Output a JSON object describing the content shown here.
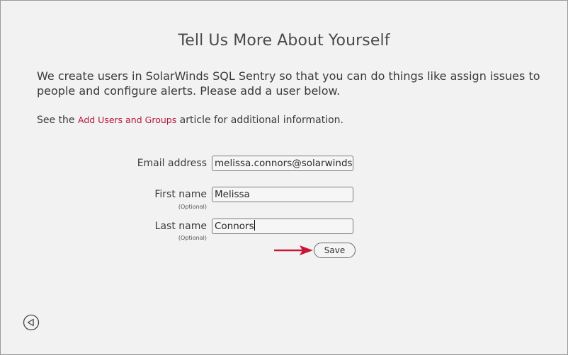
{
  "page": {
    "title": "Tell Us More About Yourself",
    "intro": "We create users in SolarWinds SQL Sentry so that you can do things like assign issues to people and configure alerts. Please add a user below.",
    "see_prefix": "See the ",
    "link_text": "Add Users and Groups",
    "see_suffix": " article for additional information."
  },
  "form": {
    "email": {
      "label": "Email address",
      "value": "melissa.connors@solarwinds.com"
    },
    "first_name": {
      "label": "First name",
      "optional": "(Optional)",
      "value": "Melissa"
    },
    "last_name": {
      "label": "Last name",
      "optional": "(Optional)",
      "value": "Connors"
    },
    "save_label": "Save"
  },
  "icons": {
    "arrow": "arrow-right-icon",
    "back": "back-circle-icon"
  },
  "colors": {
    "link": "#b8163a",
    "arrow": "#c8163a",
    "background": "#f2f2f2"
  }
}
